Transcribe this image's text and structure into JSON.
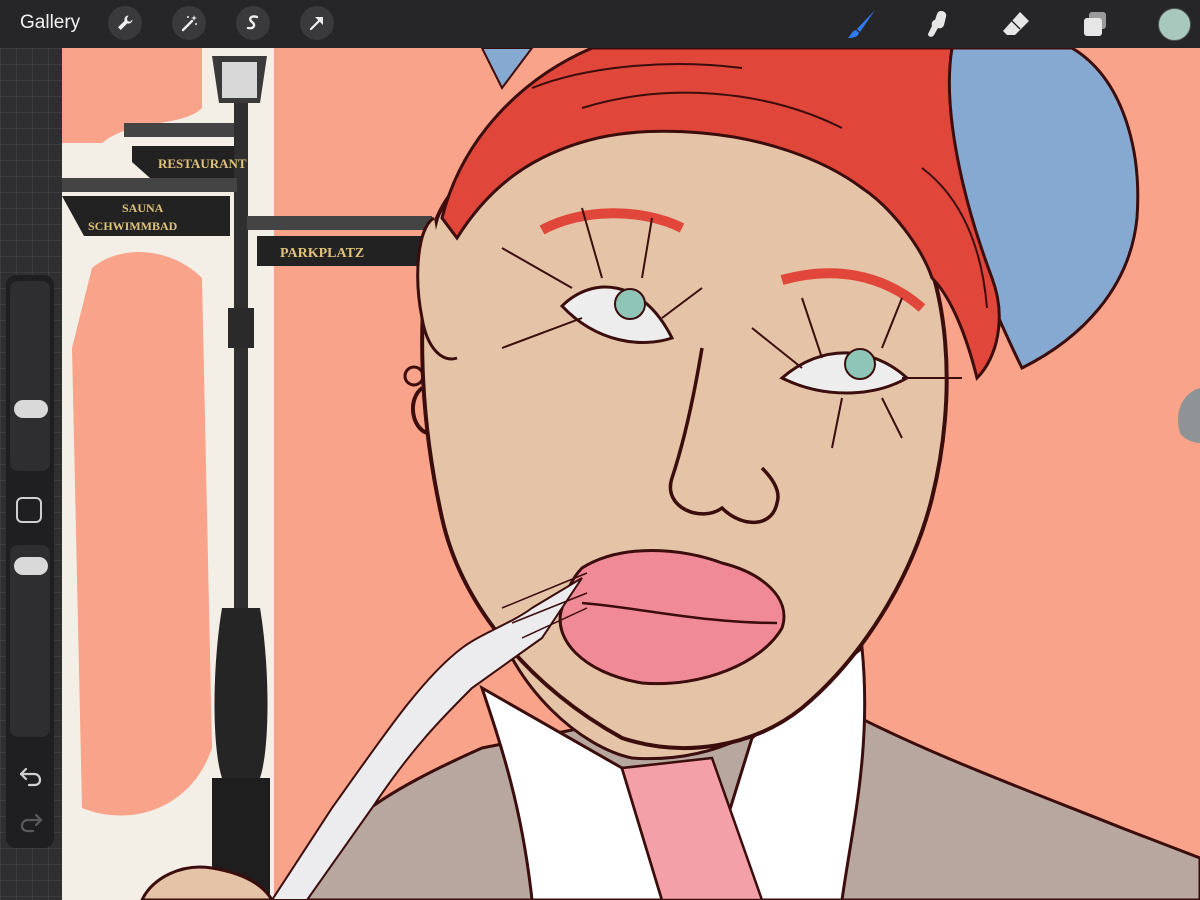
{
  "app": {
    "gallery_label": "Gallery"
  },
  "toolbar": {
    "left_tools": [
      "wrench-icon",
      "magic-wand-icon",
      "selection-icon",
      "transform-arrow-icon"
    ],
    "right_tools": [
      "brush-icon",
      "smudge-icon",
      "eraser-icon",
      "layers-icon"
    ],
    "active_tool": "brush-icon",
    "current_color": "#a9c8bd",
    "accent_color": "#2f7cf6"
  },
  "sidebar": {
    "brush_size_level": 0.3,
    "opacity_level": 0.95
  },
  "canvas": {
    "street_signs": [
      "RESTAURANT",
      "SAUNA",
      "SCHWIMMBAD",
      "PARKPLATZ"
    ]
  }
}
